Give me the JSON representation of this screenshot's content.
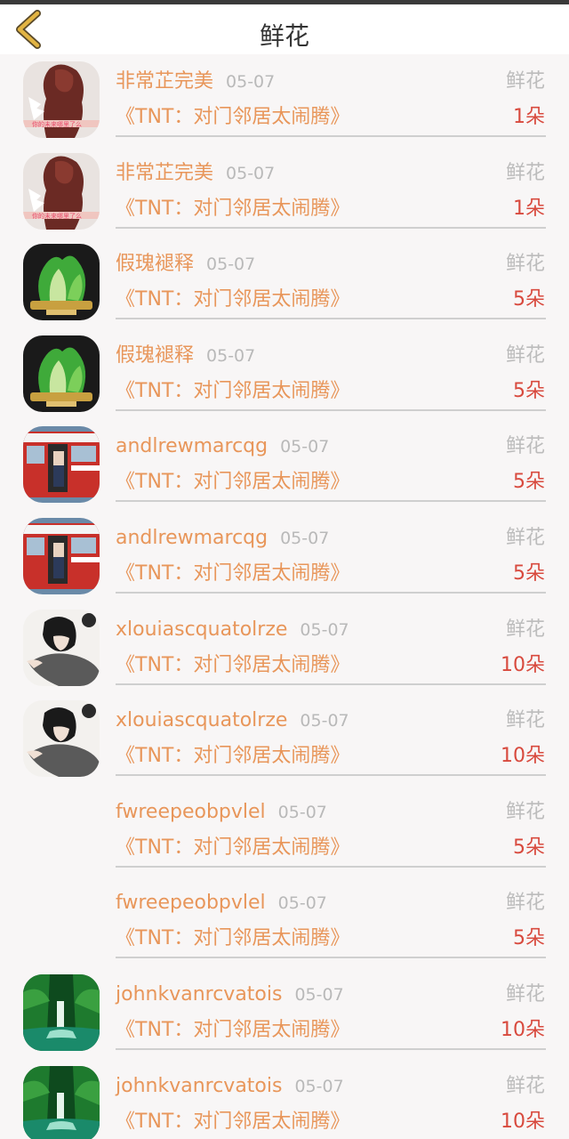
{
  "header": {
    "title": "鲜花",
    "back_icon": "chevron-left-icon"
  },
  "colors": {
    "accent": "#e8965a",
    "count": "#d84a3e",
    "muted": "#b9b9b9",
    "back": "#e2b443"
  },
  "items": [
    {
      "name": "非常芷完美",
      "date": "05-07",
      "gift": "鲜花",
      "show": "《TNT：对门邻居太闹腾》",
      "count": "1朵",
      "avatar": "woman-portrait"
    },
    {
      "name": "非常芷完美",
      "date": "05-07",
      "gift": "鲜花",
      "show": "《TNT：对门邻居太闹腾》",
      "count": "1朵",
      "avatar": "woman-portrait"
    },
    {
      "name": "假瑰褪释",
      "date": "05-07",
      "gift": "鲜花",
      "show": "《TNT：对门邻居太闹腾》",
      "count": "5朵",
      "avatar": "jade-cabbage"
    },
    {
      "name": "假瑰褪释",
      "date": "05-07",
      "gift": "鲜花",
      "show": "《TNT：对门邻居太闹腾》",
      "count": "5朵",
      "avatar": "jade-cabbage"
    },
    {
      "name": "andlrewmarcqg",
      "date": "05-07",
      "gift": "鲜花",
      "show": "《TNT：对门邻居太闹腾》",
      "count": "5朵",
      "avatar": "red-bus"
    },
    {
      "name": "andlrewmarcqg",
      "date": "05-07",
      "gift": "鲜花",
      "show": "《TNT：对门邻居太闹腾》",
      "count": "5朵",
      "avatar": "red-bus"
    },
    {
      "name": "xlouiascquatolrze",
      "date": "05-07",
      "gift": "鲜花",
      "show": "《TNT：对门邻居太闹腾》",
      "count": "10朵",
      "avatar": "anime-boy"
    },
    {
      "name": "xlouiascquatolrze",
      "date": "05-07",
      "gift": "鲜花",
      "show": "《TNT：对门邻居太闹腾》",
      "count": "10朵",
      "avatar": "anime-boy"
    },
    {
      "name": "fwreepeobpvlel",
      "date": "05-07",
      "gift": "鲜花",
      "show": "《TNT：对门邻居太闹腾》",
      "count": "5朵",
      "avatar": "none"
    },
    {
      "name": "fwreepeobpvlel",
      "date": "05-07",
      "gift": "鲜花",
      "show": "《TNT：对门邻居太闹腾》",
      "count": "5朵",
      "avatar": "none"
    },
    {
      "name": "johnkvanrcvatois",
      "date": "05-07",
      "gift": "鲜花",
      "show": "《TNT：对门邻居太闹腾》",
      "count": "10朵",
      "avatar": "waterfall"
    },
    {
      "name": "johnkvanrcvatois",
      "date": "05-07",
      "gift": "鲜花",
      "show": "《TNT：对门邻居太闹腾》",
      "count": "10朵",
      "avatar": "waterfall"
    }
  ]
}
